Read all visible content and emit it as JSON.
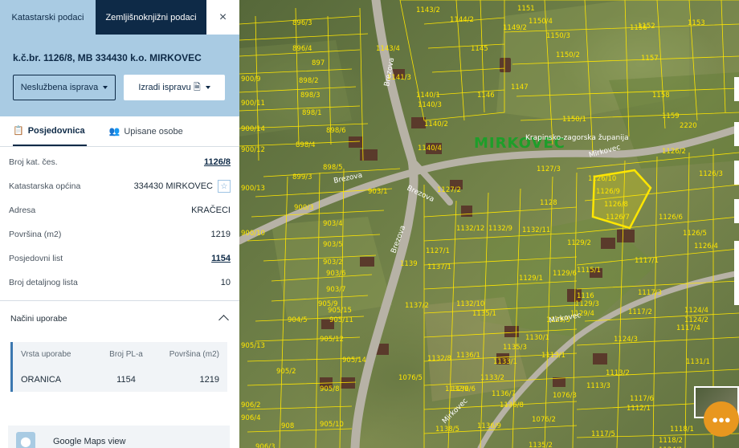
{
  "tabs": {
    "cadastral": "Katastarski podaci",
    "land_registry": "Zemljišnoknjižni podaci",
    "close": "×"
  },
  "parcel": {
    "title": "k.č.br. 1126/8, MB 334430 k.o. MIRKOVEC",
    "btn_document": "Neslužbena isprava",
    "btn_create": "Izradi ispravu",
    "btn_create_icon": "🗎"
  },
  "subtabs": {
    "ownership": "Posjedovnica",
    "ownership_icon": "📋",
    "persons": "Upisane osobe",
    "persons_icon": "👥"
  },
  "info": [
    {
      "label": "Broj kat. čes.",
      "value": "1126/8",
      "link": true
    },
    {
      "label": "Katastarska općina",
      "value": "334430 MIRKOVEC",
      "star": true
    },
    {
      "label": "Adresa",
      "value": "KRAČECI"
    },
    {
      "label": "Površina (m2)",
      "value": "1219"
    },
    {
      "label": "Posjedovni list",
      "value": "1154",
      "link": true
    },
    {
      "label": "Broj detaljnog lista",
      "value": "10"
    }
  ],
  "usage": {
    "section_title": "Načini uporabe",
    "headers": [
      "Vrsta uporabe",
      "Broj PL-a",
      "Površina (m2)"
    ],
    "rows": [
      [
        "ORANICA",
        "1154",
        "1219"
      ]
    ]
  },
  "google_maps": "Google Maps view",
  "map": {
    "settlement": "MIRKOVEC",
    "county": "Krapinsko-zagorska županija",
    "roads": [
      "Brezova",
      "Brezova",
      "Brezova",
      "Brezova",
      "Mirkovec",
      "Mirkovec",
      "Mirkovec"
    ],
    "parcels": [
      "896/3",
      "896/4",
      "897",
      "898/2",
      "898/3",
      "898/1",
      "900/9",
      "900/11",
      "900/14",
      "900/12",
      "898/4",
      "898/6",
      "899/3",
      "898/5",
      "900/13",
      "900/3",
      "900/10",
      "903/1",
      "903/2",
      "903/6",
      "903/7",
      "903/5",
      "903/4",
      "904/5",
      "905/9",
      "905/13",
      "905/12",
      "905/14",
      "905/8",
      "905/10",
      "905/11",
      "905/15",
      "905/2",
      "906/2",
      "906/4",
      "906/3",
      "908",
      "1143/2",
      "1143/4",
      "1141/3",
      "1140/1",
      "1140/2",
      "1140/4",
      "1140/3",
      "1144/2",
      "1145",
      "1146",
      "1147",
      "1149/2",
      "1150/4",
      "1150/2",
      "1150/3",
      "1150/1",
      "1151",
      "1152",
      "1153",
      "1156",
      "1157",
      "1158",
      "1159",
      "2220",
      "1126/2",
      "1126/3",
      "1127/3",
      "1126/10",
      "1126/9",
      "1126/8",
      "1126/7",
      "1126/6",
      "1126/5",
      "1126/4",
      "1127/1",
      "1127/2",
      "1128",
      "1129/2",
      "1129/1",
      "1129/6",
      "1115/1",
      "1132/12",
      "1132/9",
      "1132/11",
      "1139",
      "1137/1",
      "1137/2",
      "1132/10",
      "1135/1",
      "1136/1",
      "1130/1",
      "1129/5",
      "1129/4",
      "1129/3",
      "1116",
      "1117/1",
      "1117/3",
      "1117/2",
      "1124/3",
      "1124/4",
      "1124/2",
      "1117/4",
      "1131/1",
      "1132/8",
      "1133/1",
      "1132/2",
      "1133/2",
      "1136/6",
      "1136/7",
      "1136/8",
      "1136/9",
      "1138/5",
      "1076/5",
      "1076/3",
      "1076/2",
      "1135/2",
      "1135/3",
      "1113/1",
      "1113/2",
      "1113/3",
      "1117/5",
      "1117/6",
      "1112/1",
      "1118/1",
      "1118/2",
      "1124/1"
    ]
  }
}
